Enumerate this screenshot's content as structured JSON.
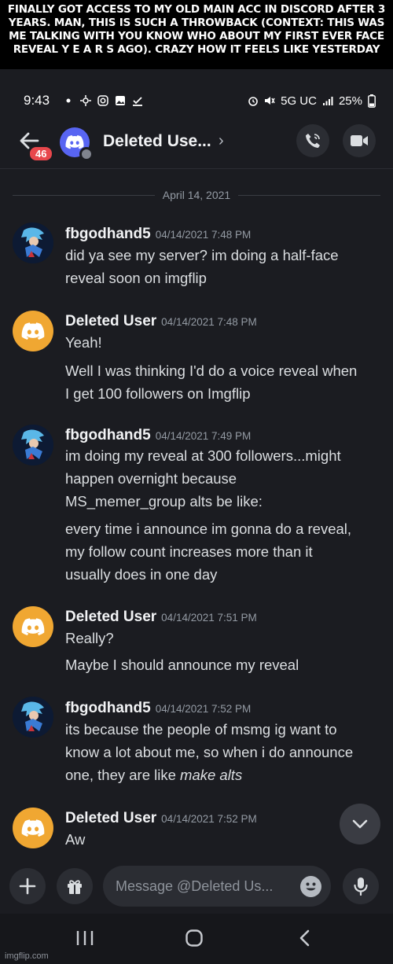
{
  "caption": "FINALLY GOT ACCESS TO MY OLD MAIN ACC IN DISCORD AFTER 3 YEARS. MAN, THIS IS SUCH A THROWBACK (CONTEXT: THIS WAS ME TALKING WITH YOU KNOW WHO ABOUT MY FIRST EVER FACE REVEAL Y E A R S AGO). CRAZY HOW IT FEELS LIKE YESTERDAY",
  "status_bar": {
    "time": "9:43",
    "network": "5G UC",
    "battery": "25%"
  },
  "header": {
    "title": "Deleted Use...",
    "back_badge": "46",
    "chevron": "›",
    "icons": [
      "phone-icon",
      "video-icon"
    ]
  },
  "date_divider": "April 14, 2021",
  "messages": [
    {
      "author": "fbgodhand5",
      "timestamp": "04/14/2021 7:48 PM",
      "lines": [
        "did ya see my server? im doing a half-face",
        "reveal soon on imgflip"
      ]
    },
    {
      "author": "Deleted User",
      "timestamp": "04/14/2021 7:48 PM",
      "lines": [
        "Yeah!",
        "Well I was thinking I'd do a voice reveal when",
        "I get 100 followers on Imgflip"
      ]
    },
    {
      "author": "fbgodhand5",
      "timestamp": "04/14/2021 7:49 PM",
      "lines": [
        "im doing my reveal at 300 followers...might",
        "happen overnight because",
        "MS_memer_group alts be like:",
        "every time i announce im gonna do a reveal,",
        "my follow count increases more than it",
        "usually does in one day"
      ]
    },
    {
      "author": "Deleted User",
      "timestamp": "04/14/2021 7:51 PM",
      "lines": [
        "Really?",
        "Maybe I should announce my reveal"
      ]
    },
    {
      "author": "fbgodhand5",
      "timestamp": "04/14/2021 7:52 PM",
      "lines": [
        "its because the people of msmg ig want to",
        "know a lot about me, so when i do announce",
        "one, they are like "
      ],
      "italic": "make alts"
    },
    {
      "author": "Deleted User",
      "timestamp": "04/14/2021 7:52 PM",
      "lines": [
        "Aw"
      ]
    }
  ],
  "composer": {
    "placeholder": "Message @Deleted Us...",
    "icons": [
      "plus-icon",
      "gift-icon",
      "emoji-icon",
      "microphone-icon"
    ]
  },
  "watermark": "imgflip.com",
  "colors": {
    "background": "#1b1c21",
    "blurple": "#5865f2",
    "deleted_avatar": "#f0a732",
    "badge_red": "#e8474c"
  }
}
